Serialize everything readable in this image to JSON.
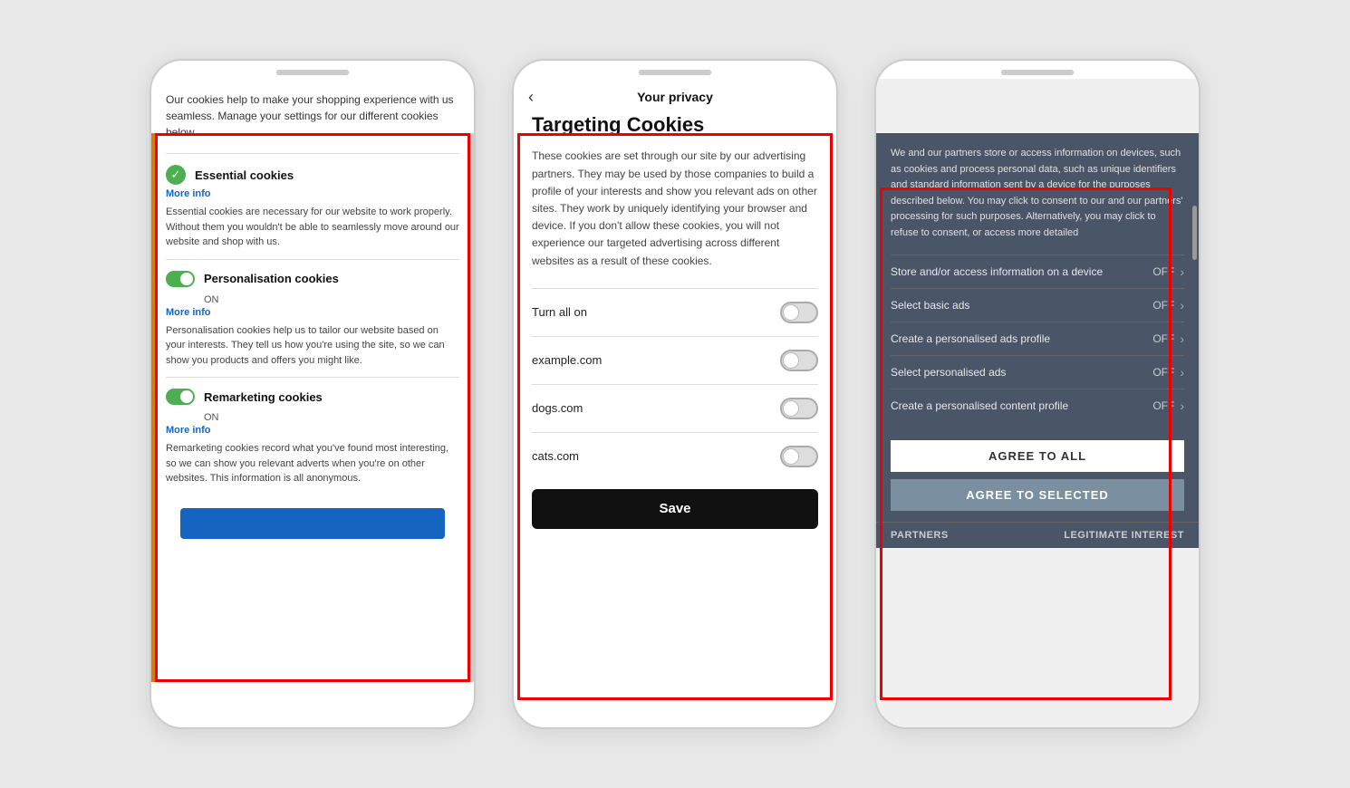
{
  "phone1": {
    "intro": "Our cookies help to make your shopping experience with us seamless. Manage your settings for our different cookies below.",
    "sections": [
      {
        "id": "essential",
        "title": "Essential cookies",
        "more_info": "More info",
        "toggle_type": "check",
        "on_label": "",
        "description": "Essential cookies are necessary for our website to work properly. Without them you wouldn't be able to seamlessly move around our website and shop with us."
      },
      {
        "id": "personalisation",
        "title": "Personalisation cookies",
        "more_info": "More info",
        "toggle_type": "toggle",
        "on_label": "ON",
        "description": "Personalisation cookies help us to tailor our website based on your interests. They tell us how you're using the site, so we can show you products and offers you might like."
      },
      {
        "id": "remarketing",
        "title": "Remarketing cookies",
        "more_info": "More info",
        "toggle_type": "toggle",
        "on_label": "ON",
        "description": "Remarketing cookies record what you've found most interesting, so we can show you relevant adverts when you're on other websites. This information is all anonymous."
      }
    ]
  },
  "phone2": {
    "back_label": "‹",
    "nav_title": "Your privacy",
    "main_title": "Targeting Cookies",
    "description": "These cookies are set through our site by our advertising partners. They may be used by those companies to build a profile of your interests and show you relevant ads on other sites. They work by uniquely identifying your browser and device. If you don't allow these cookies, you will not experience our targeted advertising across different websites as a result of these cookies.",
    "toggle_rows": [
      {
        "label": "Turn all on",
        "state": "off"
      },
      {
        "label": "example.com",
        "state": "off"
      },
      {
        "label": "dogs.com",
        "state": "off"
      },
      {
        "label": "cats.com",
        "state": "off"
      }
    ],
    "save_button": "Save"
  },
  "phone3": {
    "intro_text": "We and our partners store or access information on devices, such as cookies and process personal data, such as unique identifiers and standard information sent by a device for the purposes described below. You may click to consent to our and our partners' processing for such purposes. Alternatively, you may click to refuse to consent, or access more detailed",
    "preferences": [
      {
        "label": "Store and/or access information on a device",
        "value": "OFF"
      },
      {
        "label": "Select basic ads",
        "value": "OFF"
      },
      {
        "label": "Create a personalised ads profile",
        "value": "OFF"
      },
      {
        "label": "Select personalised ads",
        "value": "OFF"
      },
      {
        "label": "Create a personalised content profile",
        "value": "OFF"
      }
    ],
    "agree_all_label": "AGREE TO ALL",
    "agree_selected_label": "AGREE TO SELECTED",
    "footer_left": "PARTNERS",
    "footer_right": "LEGITIMATE INTEREST"
  }
}
